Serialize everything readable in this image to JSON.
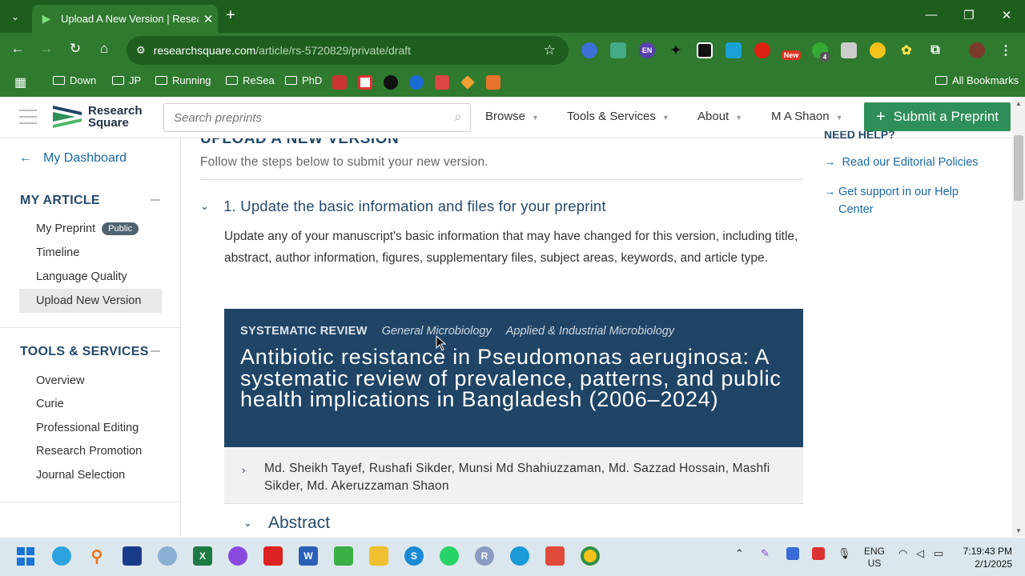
{
  "browser": {
    "tab_title": "Upload A New Version | Researc",
    "url_domain": "researchsquare.com",
    "url_path": "/article/rs-5720829/private/draft",
    "ext_badges": [
      "EN",
      "New",
      "4"
    ],
    "bookmarks": [
      "Down",
      "JP",
      "Running",
      "ReSea",
      "PhD"
    ],
    "all_bookmarks": "All Bookmarks"
  },
  "site": {
    "logo_line1": "Research",
    "logo_line2": "Square",
    "search_placeholder": "Search preprints",
    "nav": [
      "Browse",
      "Tools & Services",
      "About",
      "M A Shaon"
    ],
    "submit_label": "Submit a Preprint",
    "brand_color": "#2f8f58",
    "header_color": "#1f4466"
  },
  "sidebar": {
    "dashboard": "My Dashboard",
    "section1": "MY ARTICLE",
    "article_items": [
      "My Preprint",
      "Timeline",
      "Language Quality",
      "Upload New Version"
    ],
    "public_badge": "Public",
    "section2": "TOOLS & SERVICES",
    "tool_items": [
      "Overview",
      "Curie",
      "Professional Editing",
      "Research Promotion",
      "Journal Selection"
    ]
  },
  "main": {
    "heading": "UPLOAD A NEW VERSION",
    "subheading": "Follow the steps below to submit your new version.",
    "step1_title": "1. Update the basic information and files for your preprint",
    "step1_desc": "Update any of your manuscript's basic information that may have changed for this version, including title, abstract, author information, figures, supplementary files, subject areas, keywords, and article type.",
    "article_type": "SYSTEMATIC REVIEW",
    "subjects": [
      "General Microbiology",
      "Applied & Industrial Microbiology"
    ],
    "article_title": "Antibiotic resistance in Pseudomonas aeruginosa: A systematic review of prevalence, patterns, and public health implications in Bangladesh (2006–2024)",
    "authors": "Md. Sheikh Tayef, Rushafi Sikder, Munsi Md Shahiuzzaman, Md. Sazzad Hossain, Mashfi Sikder, Md. Akeruzzaman Shaon",
    "abstract_label": "Abstract"
  },
  "help": {
    "heading": "NEED HELP?",
    "links": [
      "Read our Editorial Policies",
      "Get support in our Help Center"
    ]
  },
  "taskbar": {
    "lang1": "ENG",
    "lang2": "US",
    "time": "7:19:43 PM",
    "date": "2/1/2025"
  }
}
